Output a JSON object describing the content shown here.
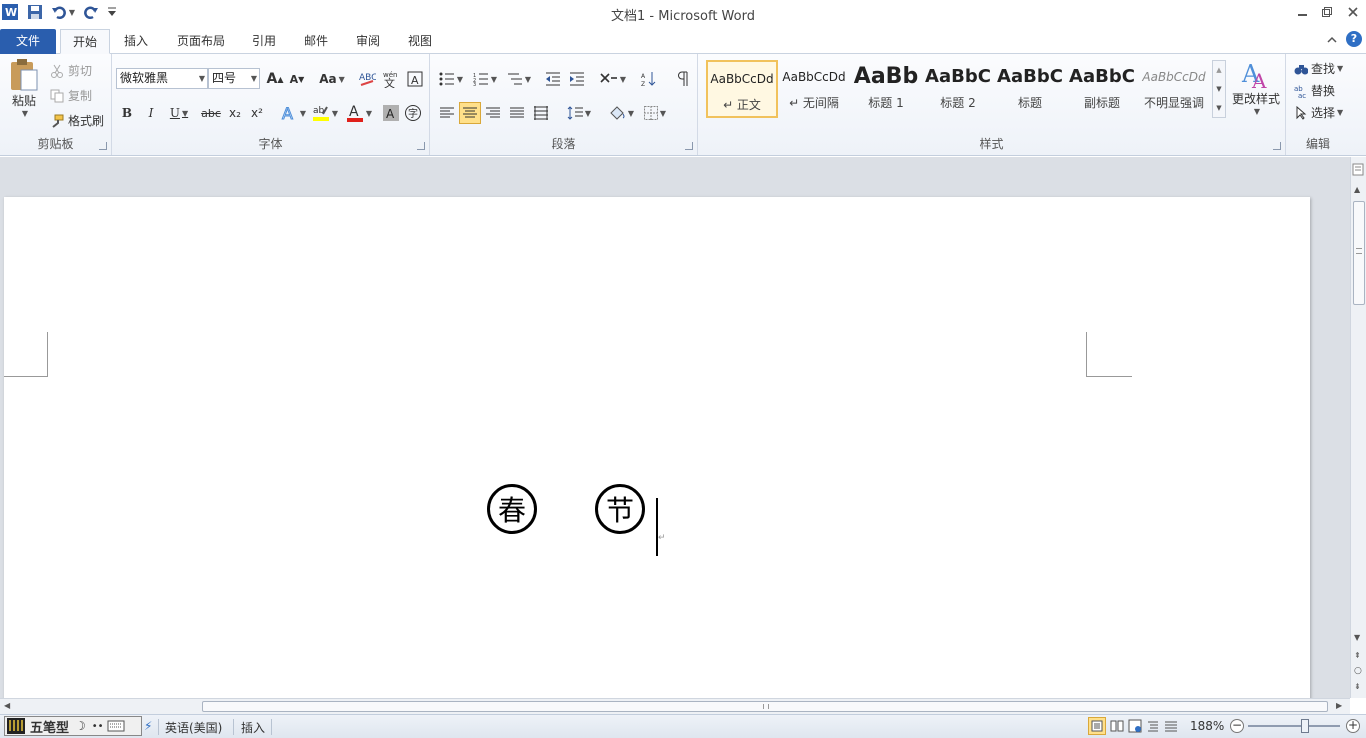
{
  "window": {
    "title": "文档1  -  Microsoft Word"
  },
  "ribbon_tabs": [
    "文件",
    "开始",
    "插入",
    "页面布局",
    "引用",
    "邮件",
    "审阅",
    "视图"
  ],
  "clipboard": {
    "paste": "粘贴",
    "cut": "剪切",
    "copy": "复制",
    "format_painter": "格式刷",
    "group_label": "剪贴板"
  },
  "font": {
    "font_name": "微软雅黑",
    "font_size": "四号",
    "grow_label": "A",
    "shrink_label": "A",
    "case_label": "Aa",
    "bold": "B",
    "italic": "I",
    "underline": "U",
    "strike": "abc",
    "subscript": "x₂",
    "superscript": "x²",
    "color_label": "A",
    "shade_label": "A",
    "enclose_label": "字",
    "highlight_label": "ab",
    "effects_label": "A",
    "wen_label": "wén",
    "clear_label": "A",
    "group_label": "字体"
  },
  "paragraph": {
    "group_label": "段落"
  },
  "styles": {
    "items": [
      {
        "sample": "AaBbCcDd",
        "name": "↵ 正文"
      },
      {
        "sample": "AaBbCcDd",
        "name": "↵ 无间隔"
      },
      {
        "sample": "AaBb",
        "name": "标题 1"
      },
      {
        "sample": "AaBbC",
        "name": "标题 2"
      },
      {
        "sample": "AaBbC",
        "name": "标题"
      },
      {
        "sample": "AaBbC",
        "name": "副标题"
      },
      {
        "sample": "AaBbCcDd",
        "name": "不明显强调"
      }
    ],
    "change_styles": "更改样式",
    "group_label": "样式"
  },
  "editing": {
    "find": "查找",
    "replace": "替换",
    "select": "选择",
    "group_label": "编辑"
  },
  "document": {
    "enclosed_chars": [
      "春",
      "节"
    ]
  },
  "statusbar": {
    "ime_mode": "五笔型",
    "language": "英语(美国)",
    "insert_mode": "插入",
    "zoom": "188%"
  },
  "colors": {
    "file_tab": "#2a5eae",
    "selected_style_border": "#f1c25c",
    "font_color_bar": "#e0201b",
    "highlight_bar": "#ffff00"
  }
}
